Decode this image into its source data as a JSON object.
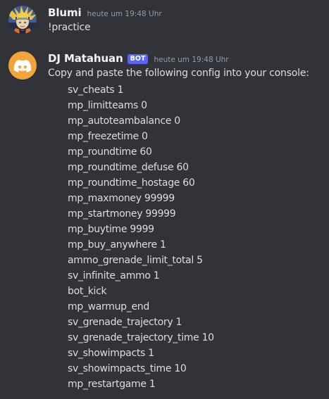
{
  "messages": [
    {
      "username": "Blumi",
      "timestamp": "heute um 19:48 Uhr",
      "content": "!practice"
    },
    {
      "username": "DJ Matahuan",
      "badge": "BOT",
      "timestamp": "heute um 19:48 Uhr",
      "intro": "Copy and paste the following config into your console:",
      "config_lines": [
        "sv_cheats 1",
        "mp_limitteams 0",
        "mp_autoteambalance 0",
        "mp_freezetime 0",
        "mp_roundtime 60",
        "mp_roundtime_defuse 60",
        "mp_roundtime_hostage 60",
        "mp_maxmoney 99999",
        "mp_startmoney 99999",
        "mp_buytime 9999",
        "mp_buy_anywhere 1",
        "ammo_grenade_limit_total 5",
        "sv_infinite_ammo 1",
        "bot_kick",
        "mp_warmup_end",
        "sv_grenade_trajectory 1",
        "sv_grenade_trajectory_time 10",
        "sv_showimpacts 1",
        "sv_showimpacts_time 10",
        "mp_restartgame 1"
      ]
    }
  ],
  "colors": {
    "background": "#313338",
    "username": "#f2f3f5",
    "message_text": "#dbdee1",
    "timestamp": "#949ba4",
    "bot_badge": "#5865f2",
    "bot_avatar": "#f0a53a"
  },
  "icons": {
    "user_avatar": "anime-character-avatar",
    "bot_avatar": "discord-logo-icon"
  }
}
